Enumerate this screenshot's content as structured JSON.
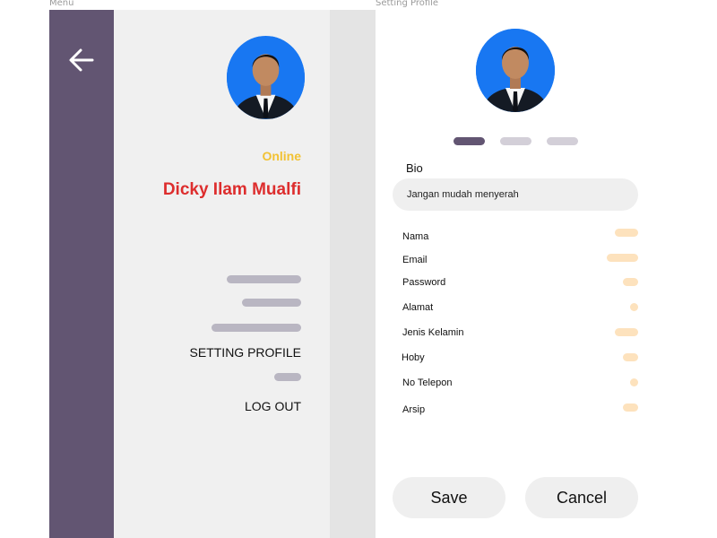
{
  "frames": {
    "menu_label": "Menu",
    "profile_label": "Setting Profile"
  },
  "menu": {
    "back_icon": "arrow-left-icon",
    "status": "Online",
    "user_name": "Dicky Ilam Mualfi",
    "setting_profile_label": "SETTING PROFILE",
    "logout_label": "LOG OUT"
  },
  "profile": {
    "carousel_dots": 3,
    "carousel_active_index": 0,
    "bio_label": "Bio",
    "bio_value": "Jangan mudah menyerah",
    "fields": [
      "Nama",
      "Email",
      "Password",
      "Alamat",
      "Jenis Kelamin",
      "Hoby",
      "No Telepon",
      "Arsip"
    ],
    "save_label": "Save",
    "cancel_label": "Cancel"
  },
  "colors": {
    "rail": "#625572",
    "status": "#f2c233",
    "name": "#dd2d2d",
    "menu_pill": "#b9b6c2",
    "field_pill": "#fde2bd",
    "avatar_bg": "#1877f2"
  }
}
